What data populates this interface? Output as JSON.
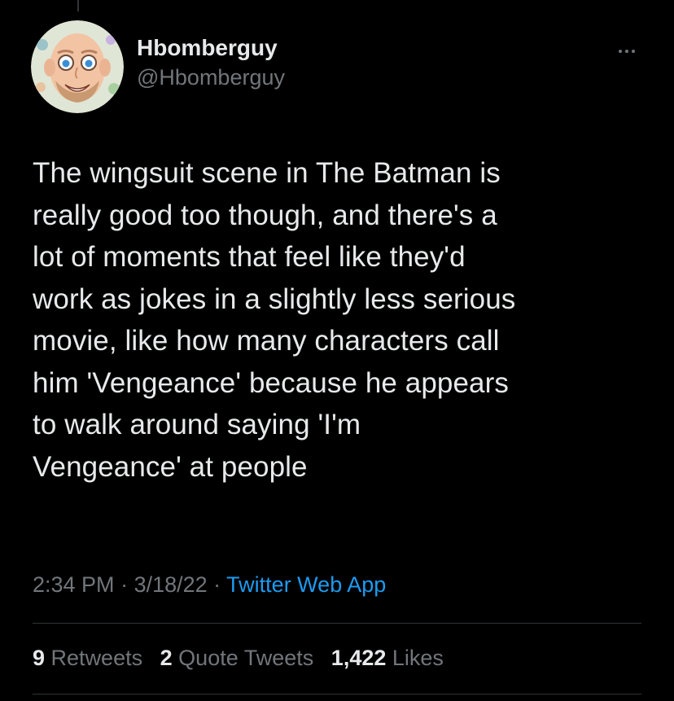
{
  "tweet": {
    "author": {
      "display_name": "Hbomberguy",
      "handle": "@Hbomberguy"
    },
    "text": "The wingsuit scene in The Batman is\nreally good too though, and there's a\nlot of moments that feel like they'd\nwork as jokes in a slightly less serious\nmovie, like how many characters call\nhim 'Vengeance' because he appears\nto walk around saying 'I'm\nVengeance' at people",
    "time": "2:34 PM",
    "separator": " · ",
    "date": "3/18/22",
    "source": "Twitter Web App",
    "stats": {
      "retweets_count": "9",
      "retweets_label": "Retweets",
      "quotes_count": "2",
      "quotes_label": "Quote Tweets",
      "likes_count": "1,422",
      "likes_label": "Likes"
    }
  },
  "icons": {
    "more": "more-horizontal-icon",
    "avatar": "avatar-illustration"
  },
  "colors": {
    "background": "#000000",
    "text_primary": "#e7e9ea",
    "text_secondary": "#71767b",
    "link": "#1d9bf0",
    "divider": "#2f3336"
  }
}
